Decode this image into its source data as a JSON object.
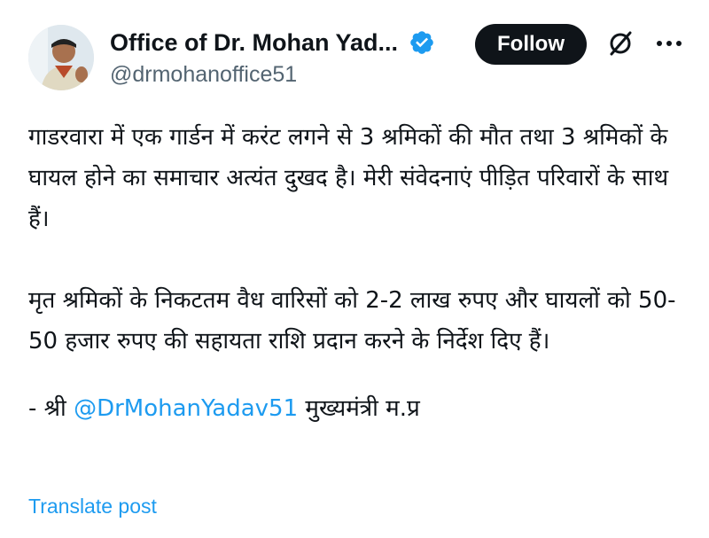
{
  "author": {
    "display_name": "Office of Dr. Mohan Yad...",
    "handle": "@drmohanoffice51",
    "verified_icon": "verified-badge-icon",
    "verified_color": "#1d9bf0"
  },
  "actions": {
    "follow_label": "Follow",
    "grok_icon": "grok-icon",
    "more_icon": "more-options-icon"
  },
  "post": {
    "paragraph_1": "गाडरवारा में एक गार्डन में करंट लगने से 3 श्रमिकों की मौत तथा 3 श्रमिकों के घायल होने का समाचार अत्यंत दुखद है। मेरी संवेदनाएं पीड़ित परिवारों के साथ हैं।",
    "paragraph_2": "मृत श्रमिकों के निकटतम वैध वारिसों को 2-2 लाख रुपए और घायलों को 50-50 हजार रुपए की सहायता राशि प्रदान करने के निर्देश दिए हैं।",
    "signature_prefix": "- श्री ",
    "signature_mention": "@DrMohanYadav51",
    "signature_suffix": " मुख्यमंत्री म.प्र"
  },
  "translate_label": "Translate post",
  "colors": {
    "text": "#0f1419",
    "secondary": "#536471",
    "link": "#1d9bf0",
    "button_bg": "#0f1419"
  }
}
